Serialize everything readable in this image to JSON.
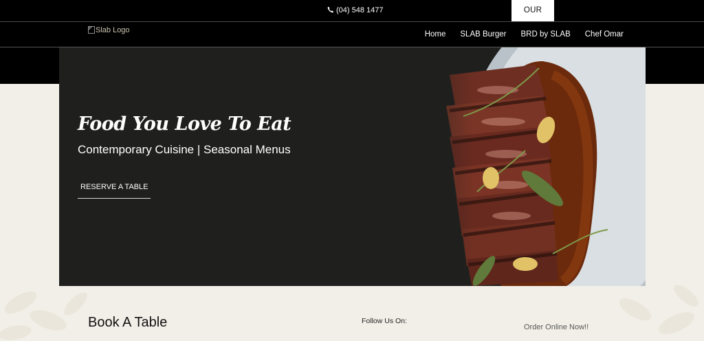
{
  "topbar": {
    "phone": "(04) 548 1477",
    "our_menu": "OUR MENU"
  },
  "header": {
    "logo_alt": "Slab Logo",
    "nav": [
      "Home",
      "SLAB Burger",
      "BRD by SLAB",
      "Chef Omar"
    ]
  },
  "hero": {
    "title": "Food You Love To Eat",
    "subtitle": "Contemporary Cuisine | Seasonal Menus",
    "cta": "RESERVE A TABLE"
  },
  "footer": {
    "book_title": "Book A Table",
    "follow": "Follow Us On:",
    "order": "Order Online Now!!"
  },
  "colors": {
    "topbar": "#000000",
    "hero_bg": "#1f201e",
    "page_bg": "#f2efe8"
  }
}
